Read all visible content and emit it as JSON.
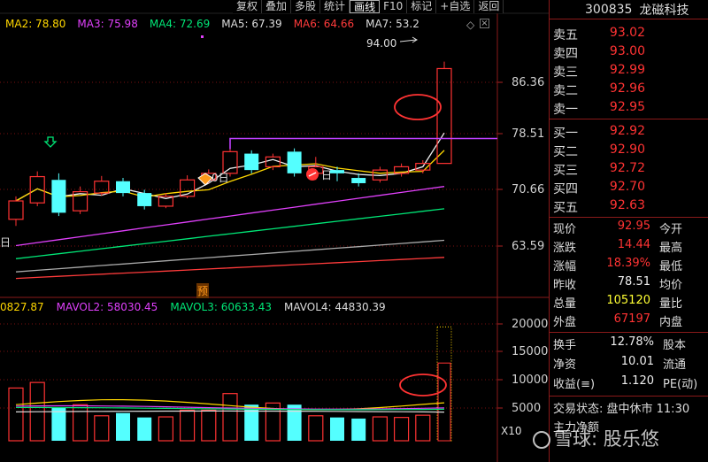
{
  "toolbar": {
    "items": [
      "复权",
      "叠加",
      "多股",
      "统计",
      "画线",
      "F10",
      "标记",
      "+自选",
      "返回"
    ],
    "active_index": 4
  },
  "ma_legend": [
    {
      "label": "MA2: 78.80",
      "color": "#ffd700"
    },
    {
      "label": "MA3: 75.98",
      "color": "#e040fb"
    },
    {
      "label": "MA4: 72.69",
      "color": "#00e676"
    },
    {
      "label": "MA5: 67.39",
      "color": "#dddddd"
    },
    {
      "label": "MA6: 64.66",
      "color": "#ff3b3b"
    },
    {
      "label": "MA7: 53.2",
      "color": "#dddddd"
    }
  ],
  "vol_legend": [
    {
      "label": "0827.87",
      "color": "#ffd700"
    },
    {
      "label": "MAVOL2: 58030.45",
      "color": "#e040fb"
    },
    {
      "label": "MAVOL3: 60633.43",
      "color": "#00e676"
    },
    {
      "label": "MAVOL4: 44830.39",
      "color": "#dddddd"
    }
  ],
  "price_axis": [
    "86.36",
    "78.51",
    "70.66",
    "63.59"
  ],
  "volume_axis": [
    "20000",
    "15000",
    "10000",
    "5000"
  ],
  "peak_label": "94.00",
  "markers": {
    "left_ri": "日",
    "zero_ri": "0日",
    "ri": "日",
    "yu": "预"
  },
  "volume_unit": "X10",
  "chart_data": {
    "type": "candlestick",
    "price_range": [
      60,
      98
    ],
    "volume_range": [
      0,
      22000
    ],
    "candles": [
      {
        "o": 70.0,
        "c": 72.8,
        "h": 73.5,
        "l": 69.0,
        "up": true
      },
      {
        "o": 72.5,
        "c": 76.5,
        "h": 77.3,
        "l": 72.0,
        "up": true
      },
      {
        "o": 76.0,
        "c": 71.0,
        "h": 77.0,
        "l": 70.5,
        "up": false
      },
      {
        "o": 71.3,
        "c": 74.2,
        "h": 75.0,
        "l": 70.8,
        "up": true
      },
      {
        "o": 74.0,
        "c": 75.8,
        "h": 76.6,
        "l": 73.6,
        "up": true
      },
      {
        "o": 75.8,
        "c": 74.0,
        "h": 76.3,
        "l": 73.5,
        "up": false
      },
      {
        "o": 74.0,
        "c": 72.0,
        "h": 74.5,
        "l": 71.5,
        "up": false
      },
      {
        "o": 72.0,
        "c": 73.5,
        "h": 74.0,
        "l": 71.7,
        "up": true
      },
      {
        "o": 73.5,
        "c": 76.0,
        "h": 76.7,
        "l": 73.2,
        "up": true
      },
      {
        "o": 76.0,
        "c": 77.0,
        "h": 77.6,
        "l": 75.5,
        "up": true
      },
      {
        "o": 77.0,
        "c": 80.3,
        "h": 81.0,
        "l": 76.5,
        "up": true
      },
      {
        "o": 80.0,
        "c": 77.5,
        "h": 80.5,
        "l": 77.0,
        "up": false
      },
      {
        "o": 78.0,
        "c": 79.5,
        "h": 80.0,
        "l": 77.5,
        "up": true
      },
      {
        "o": 80.3,
        "c": 77.0,
        "h": 80.8,
        "l": 76.5,
        "up": false
      },
      {
        "o": 77.0,
        "c": 78.0,
        "h": 79.5,
        "l": 76.0,
        "up": true
      },
      {
        "o": 77.5,
        "c": 77.0,
        "h": 78.0,
        "l": 75.8,
        "up": false
      },
      {
        "o": 76.3,
        "c": 75.5,
        "h": 77.0,
        "l": 75.0,
        "up": false
      },
      {
        "o": 76.0,
        "c": 77.5,
        "h": 78.0,
        "l": 75.6,
        "up": true
      },
      {
        "o": 77.0,
        "c": 78.0,
        "h": 78.5,
        "l": 76.5,
        "up": true
      },
      {
        "o": 77.5,
        "c": 78.51,
        "h": 79.0,
        "l": 77.0,
        "up": true
      },
      {
        "o": 78.51,
        "c": 92.95,
        "h": 94.0,
        "l": 78.51,
        "up": true
      }
    ],
    "volumes": [
      {
        "v": 9500,
        "up": true
      },
      {
        "v": 10500,
        "up": true
      },
      {
        "v": 6000,
        "up": false
      },
      {
        "v": 6500,
        "up": true
      },
      {
        "v": 4500,
        "up": true
      },
      {
        "v": 5000,
        "up": false
      },
      {
        "v": 4200,
        "up": false
      },
      {
        "v": 4300,
        "up": true
      },
      {
        "v": 5500,
        "up": true
      },
      {
        "v": 5500,
        "up": true
      },
      {
        "v": 8500,
        "up": true
      },
      {
        "v": 6500,
        "up": false
      },
      {
        "v": 6800,
        "up": true
      },
      {
        "v": 6500,
        "up": false
      },
      {
        "v": 4500,
        "up": true
      },
      {
        "v": 4200,
        "up": false
      },
      {
        "v": 4000,
        "up": false
      },
      {
        "v": 4300,
        "up": true
      },
      {
        "v": 4200,
        "up": true
      },
      {
        "v": 4600,
        "up": true
      },
      {
        "v": 20500,
        "up": true
      }
    ]
  },
  "panel": {
    "code": "300835",
    "name": "龙磁科技",
    "asks": [
      {
        "label": "卖五",
        "price": "93.02"
      },
      {
        "label": "卖四",
        "price": "93.00"
      },
      {
        "label": "卖三",
        "price": "92.99"
      },
      {
        "label": "卖二",
        "price": "92.96"
      },
      {
        "label": "卖一",
        "price": "92.95"
      }
    ],
    "bids": [
      {
        "label": "买一",
        "price": "92.92"
      },
      {
        "label": "买二",
        "price": "92.90"
      },
      {
        "label": "买三",
        "price": "92.72"
      },
      {
        "label": "买四",
        "price": "92.70"
      },
      {
        "label": "买五",
        "price": "92.63"
      }
    ],
    "quotes": [
      {
        "k": "现价",
        "v": "92.95",
        "cls": "red",
        "k2": "今开"
      },
      {
        "k": "涨跌",
        "v": "14.44",
        "cls": "red",
        "k2": "最高"
      },
      {
        "k": "涨幅",
        "v": "18.39%",
        "cls": "red",
        "k2": "最低"
      },
      {
        "k": "昨收",
        "v": "78.51",
        "cls": "white",
        "k2": "均价"
      },
      {
        "k": "总量",
        "v": "105120",
        "cls": "yellow",
        "k2": "量比"
      },
      {
        "k": "外盘",
        "v": "67197",
        "cls": "red",
        "k2": "内盘"
      }
    ],
    "stats": [
      {
        "k": "换手",
        "v": "12.78%",
        "k2": "股本"
      },
      {
        "k": "净资",
        "v": "10.01",
        "k2": "流通"
      },
      {
        "k": "收益(≡)",
        "v": "1.120",
        "k2": "PE(动)"
      }
    ],
    "status": "交易状态: 盘中休市 11:30",
    "zl": "主力净额"
  },
  "watermark": "雪球: 股乐悠"
}
